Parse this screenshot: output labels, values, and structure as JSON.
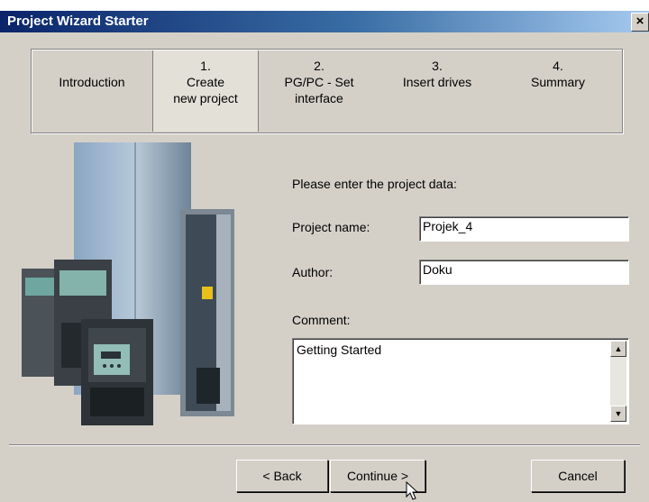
{
  "window": {
    "title": "Project Wizard Starter",
    "close_glyph": "×"
  },
  "steps": [
    {
      "label": "Introduction"
    },
    {
      "label": "1.\nCreate\nnew project"
    },
    {
      "label": "2.\nPG/PC - Set\ninterface"
    },
    {
      "label": "3.\nInsert drives"
    },
    {
      "label": "4.\nSummary"
    }
  ],
  "form": {
    "prompt": "Please enter the project data:",
    "project_name_label": "Project name:",
    "project_name_value": "Projek_4",
    "author_label": "Author:",
    "author_value": "Doku",
    "comment_label": "Comment:",
    "comment_value": "Getting Started"
  },
  "buttons": {
    "back": "< Back",
    "continue": "Continue >",
    "cancel": "Cancel"
  },
  "icons": {
    "image": "siemens-drives-photo-icon",
    "cursor": "mouse-pointer-icon"
  }
}
